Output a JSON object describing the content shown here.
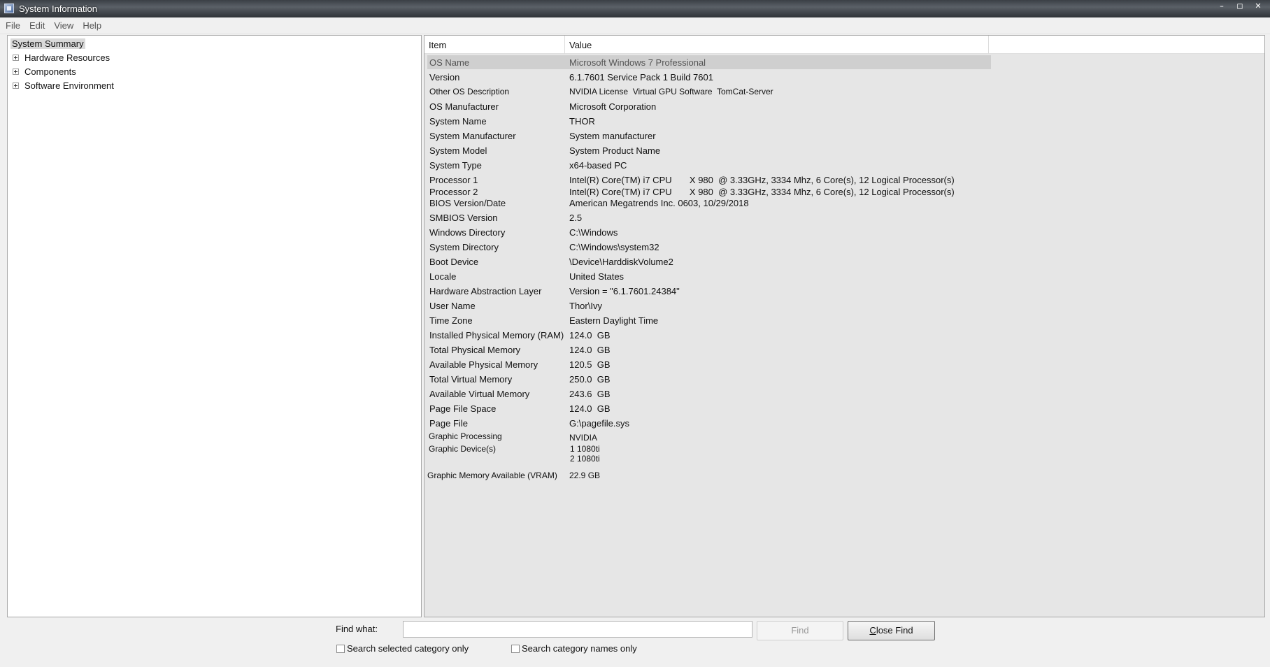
{
  "window": {
    "title": "System Information",
    "minimize_glyph": "–",
    "maximize_glyph": "◻",
    "close_glyph": "✕"
  },
  "menu": [
    "File",
    "Edit",
    "View",
    "Help"
  ],
  "tree": {
    "root": "System Summary",
    "children": [
      "Hardware Resources",
      "Components",
      "Software Environment"
    ]
  },
  "table": {
    "headers": {
      "item": "Item",
      "value": "Value"
    },
    "rows": [
      {
        "item": "OS Name",
        "value": "Microsoft Windows 7 Professional"
      },
      {
        "item": "Version",
        "value": "6.1.7601 Service Pack 1 Build 7601"
      },
      {
        "item": "Other OS Description",
        "value": "NVIDIA License  Virtual GPU Software  TomCat-Server"
      },
      {
        "item": "OS Manufacturer",
        "value": "Microsoft Corporation"
      },
      {
        "item": "System Name",
        "value": "THOR"
      },
      {
        "item": "System Manufacturer",
        "value": "System manufacturer"
      },
      {
        "item": "System Model",
        "value": "System Product Name"
      },
      {
        "item": "System Type",
        "value": "x64-based PC"
      },
      {
        "item": "Processor 1",
        "value": "Intel(R) Core(TM) i7 CPU       X 980  @ 3.33GHz, 3334 Mhz, 6 Core(s), 12 Logical Processor(s)"
      },
      {
        "item": "Processor 2",
        "value": "Intel(R) Core(TM) i7 CPU       X 980  @ 3.33GHz, 3334 Mhz, 6 Core(s), 12 Logical Processor(s)"
      },
      {
        "item": "BIOS Version/Date",
        "value": "American Megatrends Inc. 0603, 10/29/2018"
      },
      {
        "item": "SMBIOS Version",
        "value": "2.5"
      },
      {
        "item": "Windows Directory",
        "value": "C:\\Windows"
      },
      {
        "item": "System Directory",
        "value": "C:\\Windows\\system32"
      },
      {
        "item": "Boot Device",
        "value": "\\Device\\HarddiskVolume2"
      },
      {
        "item": "Locale",
        "value": "United States"
      },
      {
        "item": "Hardware Abstraction Layer",
        "value": "Version = \"6.1.7601.24384\""
      },
      {
        "item": "User Name",
        "value": "Thor\\Ivy"
      },
      {
        "item": "Time Zone",
        "value": "Eastern Daylight Time"
      },
      {
        "item": "Installed Physical Memory (RAM)",
        "value": "124.0  GB"
      },
      {
        "item": "Total Physical Memory",
        "value": "124.0  GB"
      },
      {
        "item": "Available Physical Memory",
        "value": "120.5  GB"
      },
      {
        "item": "Total Virtual Memory",
        "value": "250.0  GB"
      },
      {
        "item": "Available Virtual Memory",
        "value": "243.6  GB"
      },
      {
        "item": "Page File Space",
        "value": "124.0  GB"
      },
      {
        "item": "Page File",
        "value": "G:\\pagefile.sys"
      },
      {
        "item": "Graphic Processing",
        "value": "NVIDIA"
      },
      {
        "item": "Graphic Device(s)",
        "value": "1 1080ti\n2 1080ti"
      },
      {
        "item": "Graphic Memory Available (VRAM)",
        "value": "22.9 GB"
      }
    ]
  },
  "find": {
    "label": "Find what:",
    "value": "",
    "find_button": "Find",
    "close_button": "Close Find",
    "check_selected": "Search selected category only",
    "check_names": "Search category names only"
  }
}
